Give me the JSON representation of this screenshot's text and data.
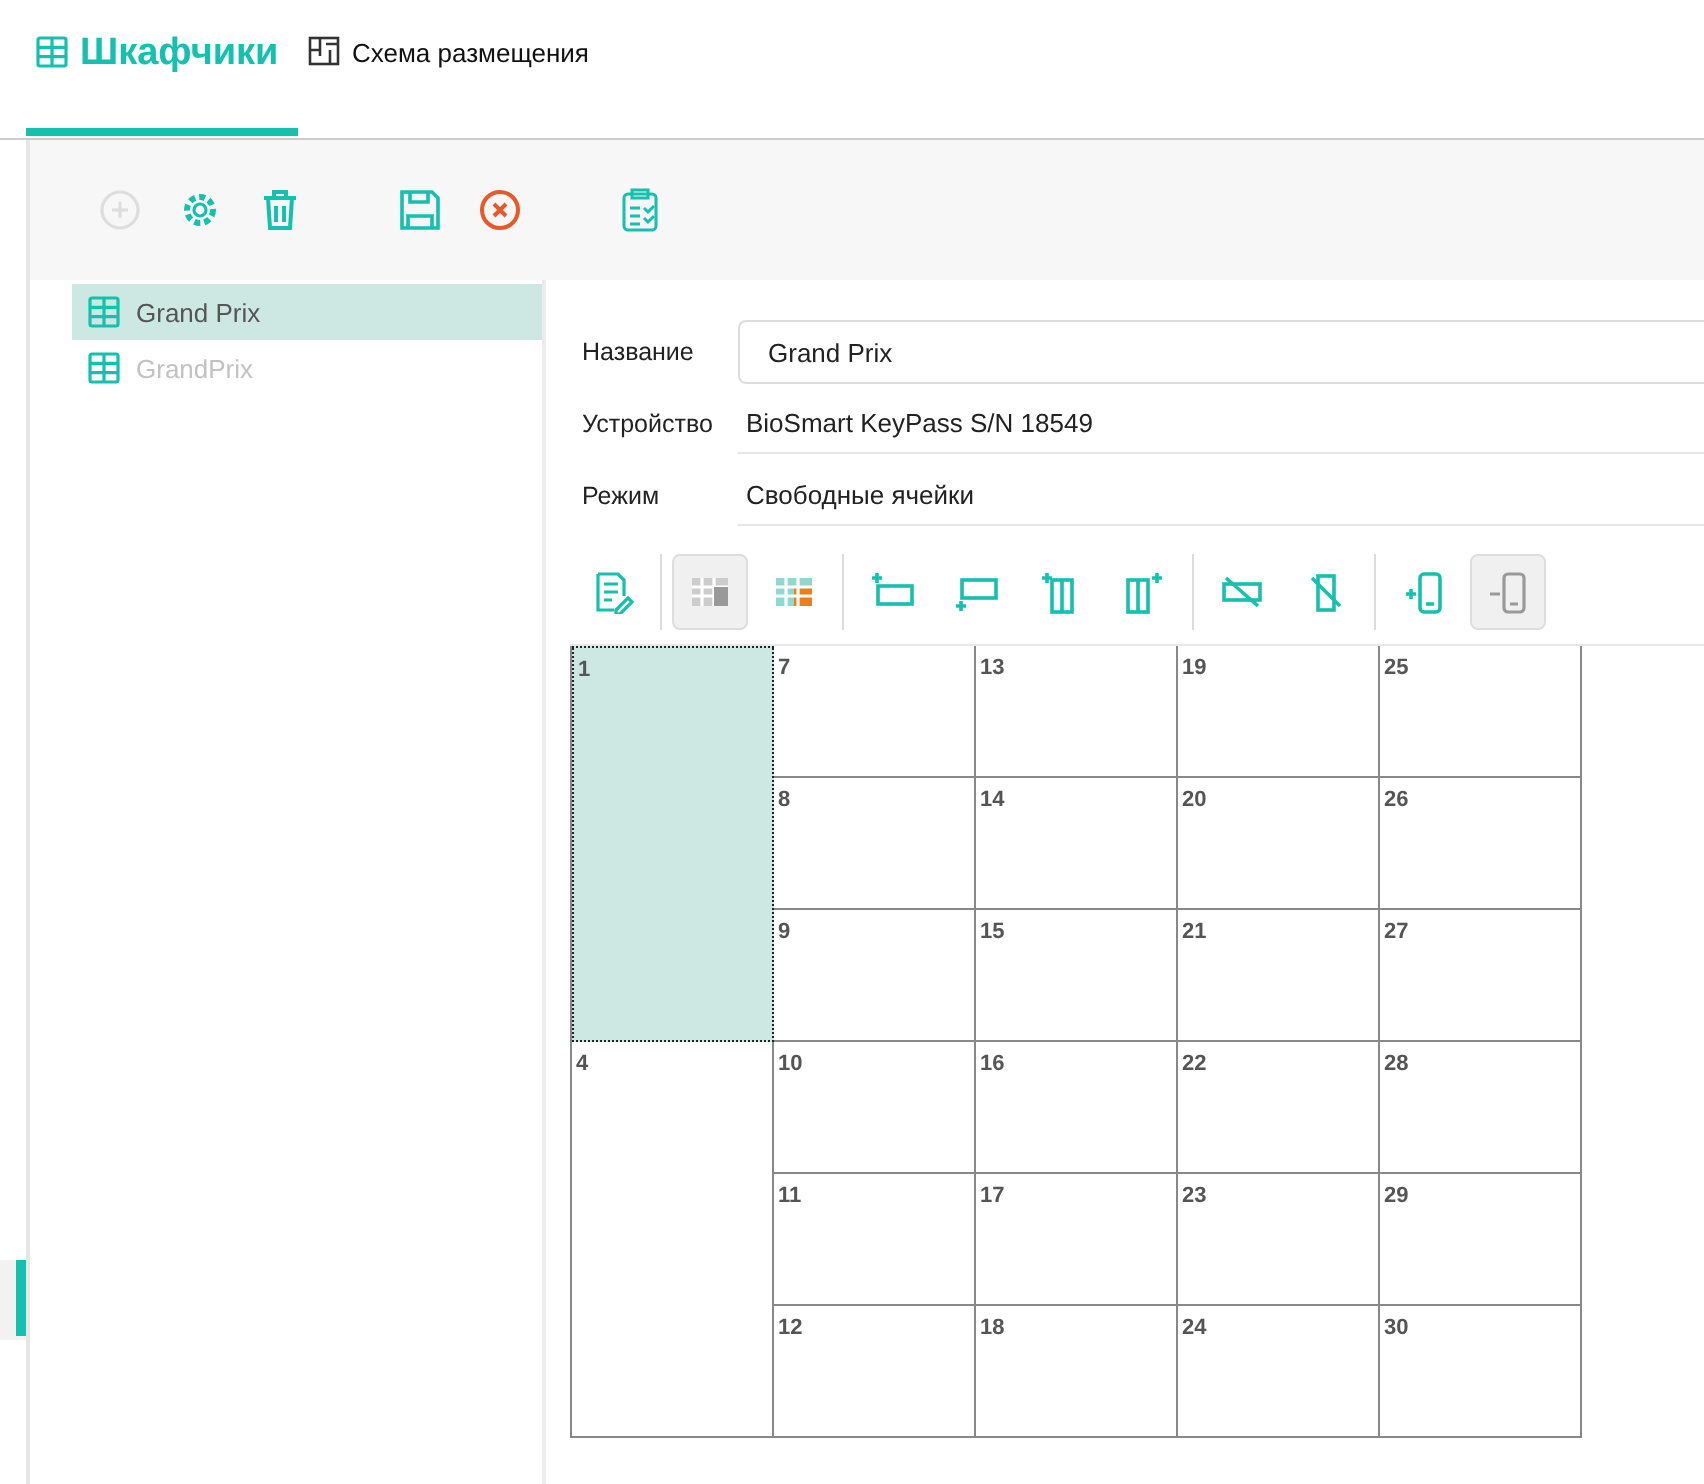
{
  "tabs": [
    {
      "label": "Шкафчики",
      "kind": "lockers",
      "selected": true
    },
    {
      "label": "Схема размещения",
      "kind": "plan",
      "selected": false
    }
  ],
  "toolbar": [
    {
      "kind": "add",
      "disabled": true
    },
    {
      "kind": "settings",
      "disabled": false
    },
    {
      "kind": "delete",
      "disabled": false
    },
    {
      "kind": "save",
      "disabled": false
    },
    {
      "kind": "cancel",
      "disabled": false
    },
    {
      "kind": "checklist",
      "disabled": false
    }
  ],
  "tree": {
    "items": [
      {
        "label": "Grand Prix",
        "selected": true,
        "disabled": false
      },
      {
        "label": "GrandPrix",
        "selected": false,
        "disabled": true
      }
    ]
  },
  "form": {
    "name": {
      "label": "Название",
      "value": "Grand Prix"
    },
    "device": {
      "label": "Устройство",
      "value": "BioSmart KeyPass S/N 18549"
    },
    "mode": {
      "label": "Режим",
      "value": "Свободные ячейки"
    }
  },
  "grid_tools": [
    [
      {
        "kind": "edit",
        "pressed": false
      }
    ],
    [
      {
        "kind": "table",
        "pressed": true
      },
      {
        "kind": "table-orange",
        "pressed": false
      }
    ],
    [
      {
        "kind": "row-top",
        "pressed": false
      },
      {
        "kind": "row-bottom",
        "pressed": false
      },
      {
        "kind": "col-left",
        "pressed": false
      },
      {
        "kind": "col-right",
        "pressed": false
      }
    ],
    [
      {
        "kind": "no-row",
        "pressed": false
      },
      {
        "kind": "no-col",
        "pressed": false
      }
    ],
    [
      {
        "kind": "device-add",
        "pressed": false
      },
      {
        "kind": "device-remove",
        "pressed": true
      }
    ]
  ],
  "columns": [
    [
      {
        "label": "1",
        "kind": "tall",
        "selected": true
      },
      {
        "label": "4",
        "kind": "tall",
        "selected": false
      }
    ],
    [
      {
        "label": "7",
        "kind": "single",
        "selected": false
      },
      {
        "label": "8",
        "kind": "single",
        "selected": false
      },
      {
        "label": "9",
        "kind": "single",
        "selected": false
      },
      {
        "label": "10",
        "kind": "single",
        "selected": false
      },
      {
        "label": "11",
        "kind": "single",
        "selected": false
      },
      {
        "label": "12",
        "kind": "single",
        "selected": false
      }
    ],
    [
      {
        "label": "13",
        "kind": "single",
        "selected": false
      },
      {
        "label": "14",
        "kind": "single",
        "selected": false
      },
      {
        "label": "15",
        "kind": "single",
        "selected": false
      },
      {
        "label": "16",
        "kind": "single",
        "selected": false
      },
      {
        "label": "17",
        "kind": "single",
        "selected": false
      },
      {
        "label": "18",
        "kind": "single",
        "selected": false
      }
    ],
    [
      {
        "label": "19",
        "kind": "single",
        "selected": false
      },
      {
        "label": "20",
        "kind": "single",
        "selected": false
      },
      {
        "label": "21",
        "kind": "single",
        "selected": false
      },
      {
        "label": "22",
        "kind": "single",
        "selected": false
      },
      {
        "label": "23",
        "kind": "single",
        "selected": false
      },
      {
        "label": "24",
        "kind": "single",
        "selected": false
      }
    ],
    [
      {
        "label": "25",
        "kind": "single",
        "selected": false
      },
      {
        "label": "26",
        "kind": "single",
        "selected": false
      },
      {
        "label": "27",
        "kind": "single",
        "selected": false
      },
      {
        "label": "28",
        "kind": "single",
        "selected": false
      },
      {
        "label": "29",
        "kind": "single",
        "selected": false
      },
      {
        "label": "30",
        "kind": "single",
        "selected": false
      }
    ]
  ]
}
